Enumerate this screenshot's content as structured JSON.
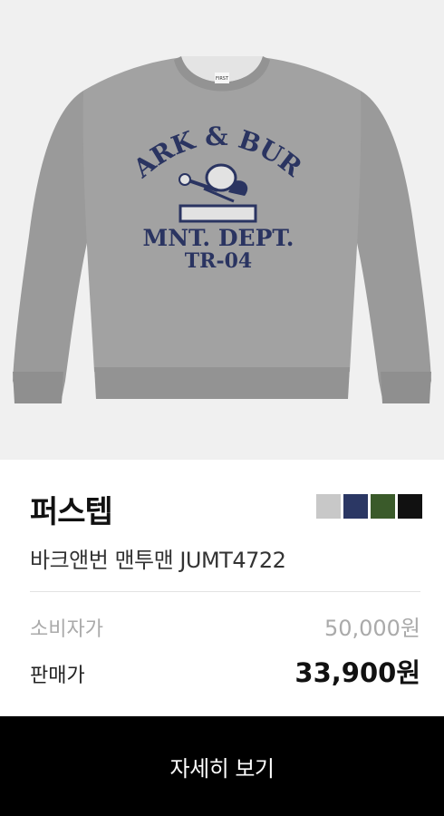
{
  "product": {
    "brand": "퍼스텝",
    "name": "바크앤번 맨투맨 JUMT4722",
    "graphic": {
      "arch_text": "BARK & BURN",
      "line1": "MNT. DEPT.",
      "line2": "TR-04",
      "neck_label": "FIRST"
    },
    "swatches": [
      {
        "name": "gray",
        "color": "#c8c8c8"
      },
      {
        "name": "navy",
        "color": "#2b3764"
      },
      {
        "name": "green",
        "color": "#3a5a2a"
      },
      {
        "name": "black",
        "color": "#111111"
      }
    ]
  },
  "price": {
    "retail_label": "소비자가",
    "retail_value": "50,000원",
    "sale_label": "판매가",
    "sale_value": "33,900원"
  },
  "cta": {
    "label": "자세히 보기"
  }
}
